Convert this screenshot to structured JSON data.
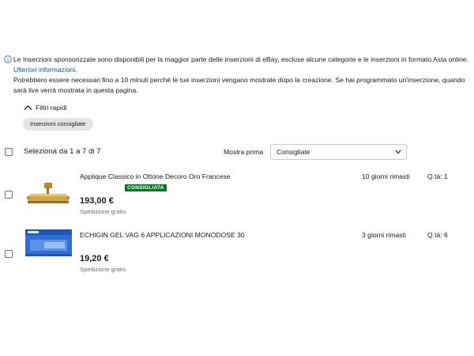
{
  "notice": {
    "text": "Le Inserzioni sponsorizzate sono disponibili per la maggior parte delle inserzioni di eBay, escluse alcune categorie e le inserzioni in formato Asta online.",
    "link": "Ulteriori informazioni.",
    "text2": "Potrebbero essere necessari fino a 10 minuti perché le tue inserzioni vengano mostrate dopo la creazione. Se hai programmato un'inserzione, quando sarà live verrà mostrata in questa pagina.",
    "icon": "info-icon"
  },
  "filters": {
    "toggle_label": "Filtri rapidi",
    "chip_label": "Inserzioni consigliate"
  },
  "selection": {
    "label": "Seleziona da 1 a 7 di 7"
  },
  "sort": {
    "label": "Mostra prima",
    "value": "Consigliate"
  },
  "listings": [
    {
      "title": "Applique Classico in Ottone Decoro Oro Francese",
      "badge": "CONSIGLIATA",
      "price": "193,00 €",
      "shipping": "Spedizione gratis",
      "time_left": "10 giorni rimasti",
      "qty": "Q.tà: 1"
    },
    {
      "title": "ECHIGIN GEL VAG 6 APPLICAZIONI MONODOSE 30",
      "price": "19,20 €",
      "shipping": "Spedizione gratis",
      "time_left": "3 giorni rimasti",
      "qty": "Q.tà: 6"
    }
  ],
  "colors": {
    "link": "#0654ba",
    "badge_bg": "#007a1e",
    "chip_bg": "#e5e5e5"
  }
}
